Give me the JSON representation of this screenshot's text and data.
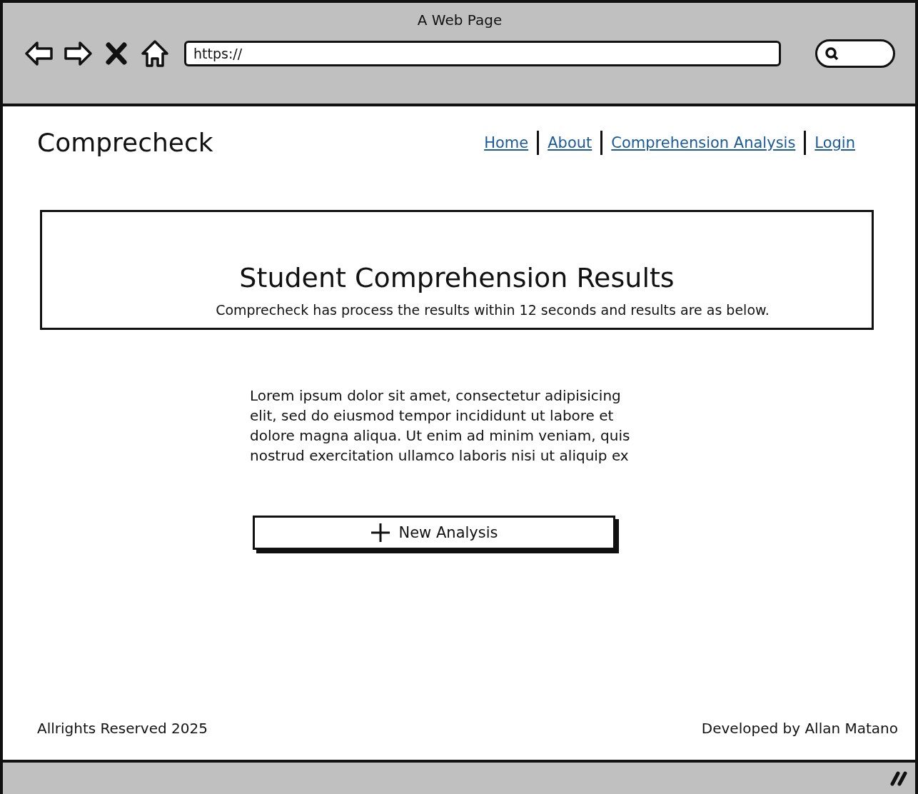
{
  "window": {
    "title": "A Web Page"
  },
  "address_bar": {
    "value": "https://"
  },
  "site": {
    "logo": "Comprecheck"
  },
  "nav": {
    "links": [
      "Home",
      "About",
      "Comprehension Analysis",
      "Login"
    ]
  },
  "banner": {
    "title": "Student Comprehension Results",
    "subtitle": "Comprecheck has process the results within 12 seconds and results are as below."
  },
  "body_text": "Lorem ipsum dolor sit amet, consectetur adipisicing elit, sed do eiusmod tempor incididunt ut labore et dolore magna aliqua. Ut enim ad minim veniam, quis nostrud exercitation ullamco laboris nisi ut aliquip ex",
  "button": {
    "label": "New Analysis"
  },
  "footer": {
    "left": "Allrights Reserved 2025",
    "right": "Developed by Allan Matano"
  }
}
